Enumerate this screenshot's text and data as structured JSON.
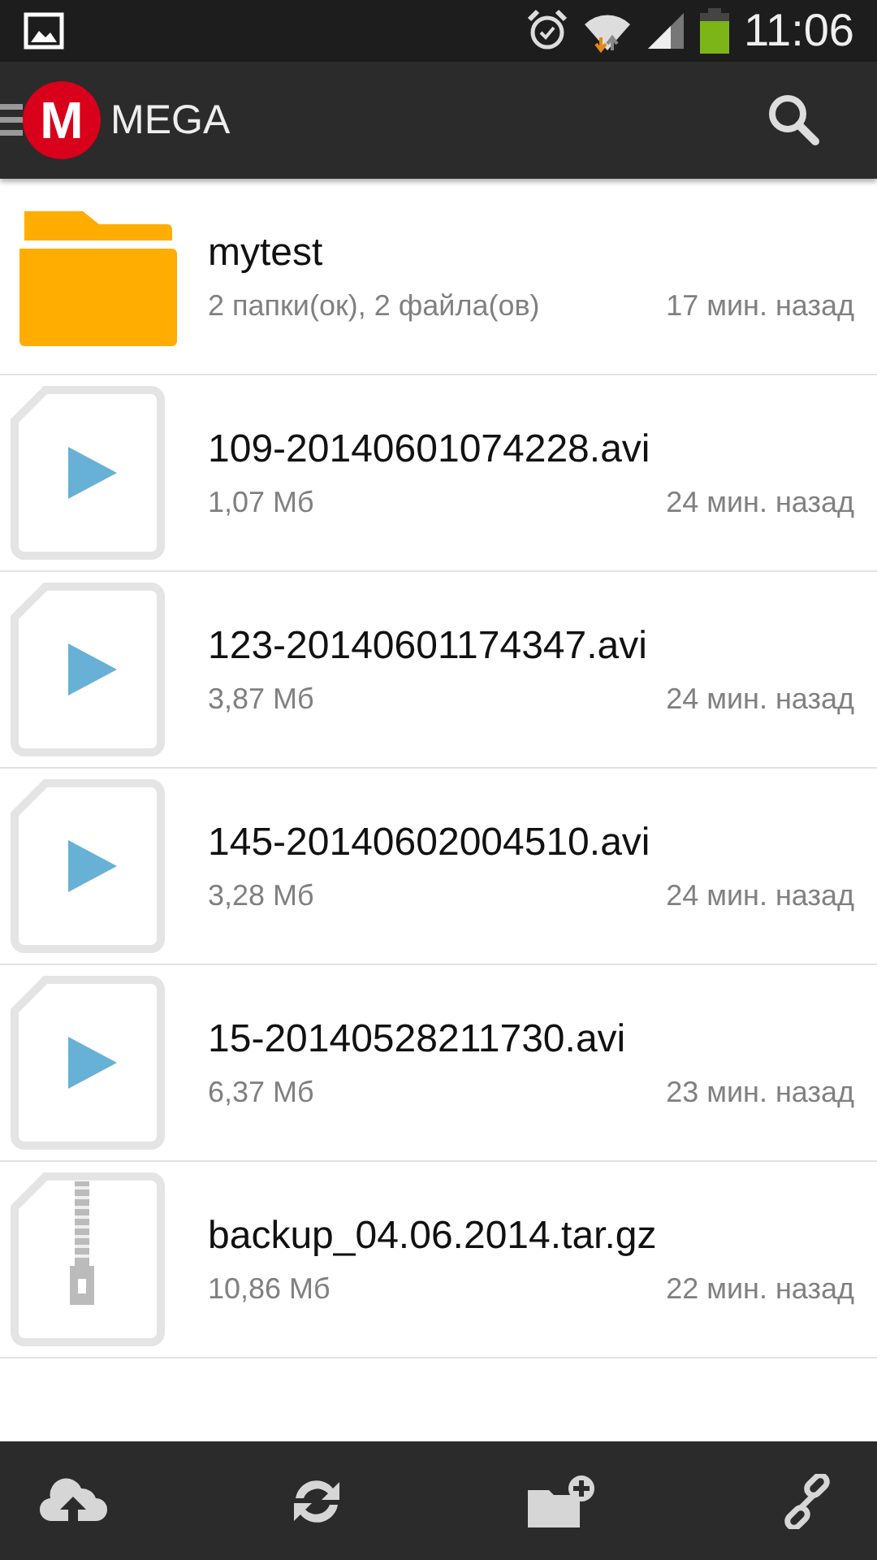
{
  "status_bar": {
    "time": "11:06"
  },
  "app_bar": {
    "title": "MEGA",
    "logo": "M"
  },
  "files": [
    {
      "kind": "folder",
      "name": "mytest",
      "info": "2 папки(ок), 2 файла(ов)",
      "time": "17 мин. назад"
    },
    {
      "kind": "video",
      "name": "109-20140601074228.avi",
      "info": "1,07 Мб",
      "time": "24 мин. назад"
    },
    {
      "kind": "video",
      "name": "123-20140601174347.avi",
      "info": "3,87 Мб",
      "time": "24 мин. назад"
    },
    {
      "kind": "video",
      "name": "145-20140602004510.avi",
      "info": "3,28 Мб",
      "time": "24 мин. назад"
    },
    {
      "kind": "video",
      "name": "15-20140528211730.avi",
      "info": "6,37 Мб",
      "time": "23 мин. назад"
    },
    {
      "kind": "archive",
      "name": "backup_04.06.2014.tar.gz",
      "info": "10,86 Мб",
      "time": "22 мин. назад"
    }
  ]
}
